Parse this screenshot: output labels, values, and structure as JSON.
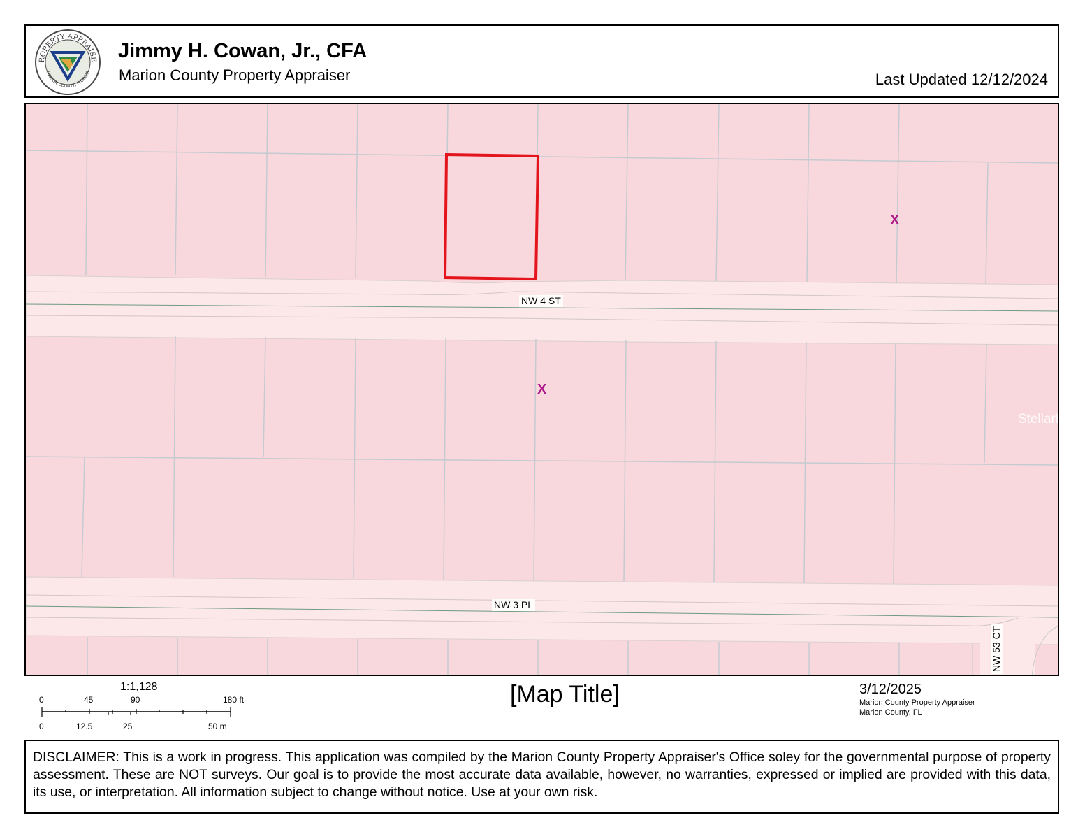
{
  "header": {
    "seal_icon": "marion-county-property-appraiser-seal",
    "seal_text_top": "PROPERTY APPRAISER",
    "seal_text_bottom": "MARION COUNTY, FLORIDA",
    "name": "Jimmy H. Cowan, Jr., CFA",
    "office": "Marion County Property Appraiser",
    "last_updated": "Last Updated 12/12/2024"
  },
  "map": {
    "background_color": "#f9d8dd",
    "road_color": "#fce8e8",
    "highlight_color": "#e3141b",
    "marker_color": "#b01b8a",
    "streets": [
      "NW 4 ST",
      "NW 3 PL",
      "NW 53 CT"
    ],
    "markers": [
      "X",
      "X"
    ],
    "watermark": "StellarMLS"
  },
  "scale": {
    "ratio": "1:1,128",
    "feet_ticks": [
      "0",
      "45",
      "90",
      "180 ft"
    ],
    "meter_ticks": [
      "0",
      "12.5",
      "25",
      "50 m"
    ]
  },
  "map_title": "[Map Title]",
  "date_block": {
    "date": "3/12/2025",
    "line1": "Marion County Property Appraiser",
    "line2": "Marion County, FL"
  },
  "disclaimer": "DISCLAIMER: This is a work in progress. This application was compiled by the Marion County Property Appraiser's Office soley for the governmental purpose of property assessment. These are NOT surveys. Our goal is to provide the most accurate data available, however, no warranties, expressed or implied are provided with this data, its use, or interpretation. All information subject to change without notice. Use at your own risk."
}
